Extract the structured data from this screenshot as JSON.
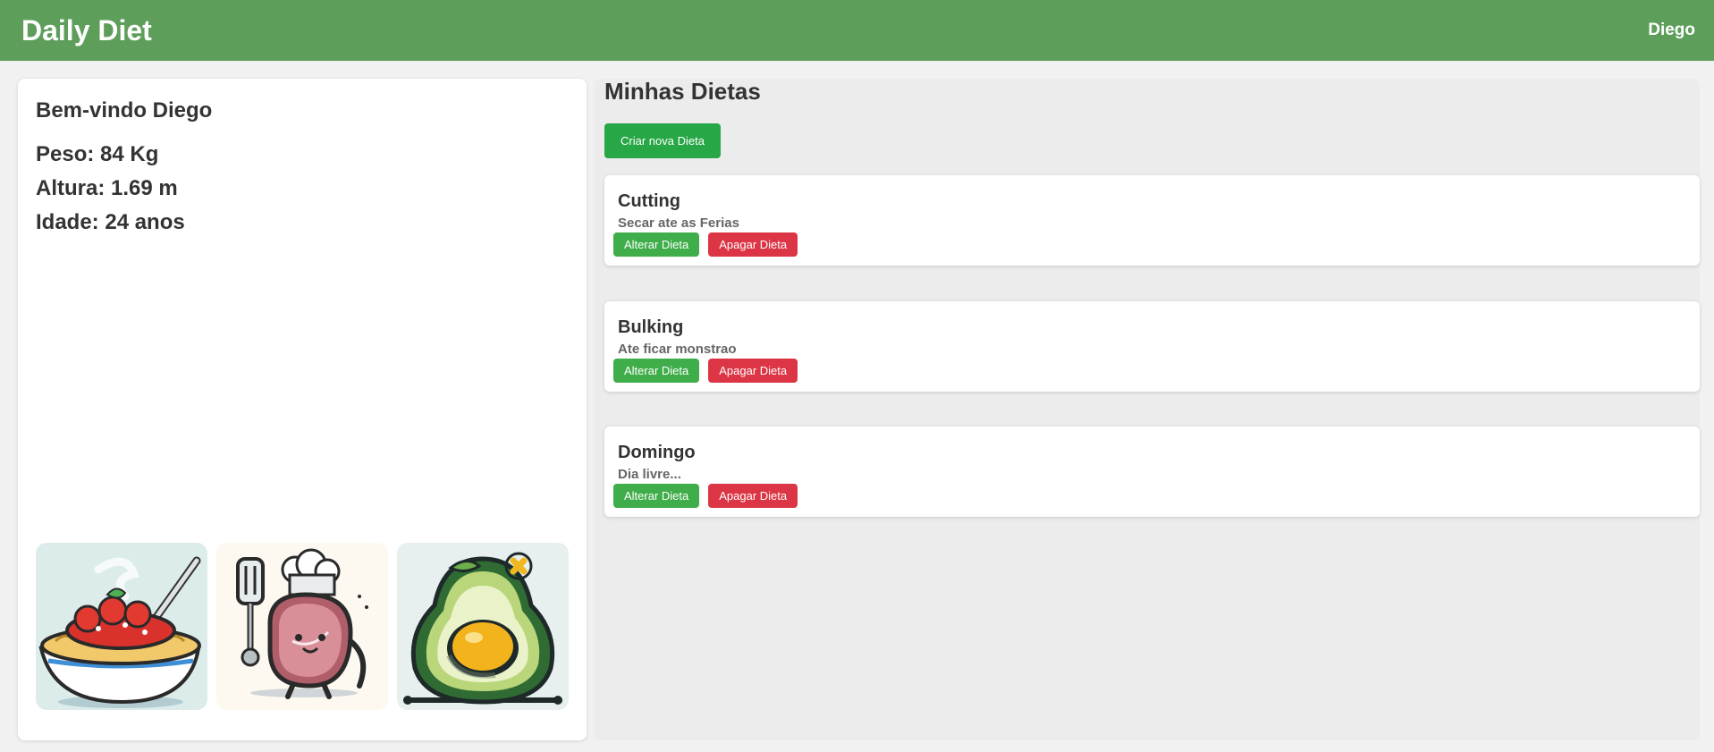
{
  "header": {
    "brand": "Daily Diet",
    "user": "Diego"
  },
  "profile": {
    "welcome": "Bem-vindo Diego",
    "weight": "Peso: 84 Kg",
    "height": "Altura: 1.69 m",
    "age": "Idade: 24 anos",
    "images": [
      "spaghetti-bowl-illustration",
      "steak-chef-illustration",
      "avocado-egg-illustration"
    ]
  },
  "diets": {
    "title": "Minhas Dietas",
    "create_label": "Criar nova Dieta",
    "items": [
      {
        "name": "Cutting",
        "description": "Secar ate as Ferias",
        "edit_label": "Alterar Dieta",
        "delete_label": "Apagar Dieta"
      },
      {
        "name": "Bulking",
        "description": "Ate ficar monstrao",
        "edit_label": "Alterar Dieta",
        "delete_label": "Apagar Dieta"
      },
      {
        "name": "Domingo",
        "description": "Dia livre...",
        "edit_label": "Alterar Dieta",
        "delete_label": "Apagar Dieta"
      }
    ]
  },
  "colors": {
    "header": "#5d9e5b",
    "create_button": "#27a745",
    "edit_button": "#3fad49",
    "delete_button": "#dc3545"
  }
}
